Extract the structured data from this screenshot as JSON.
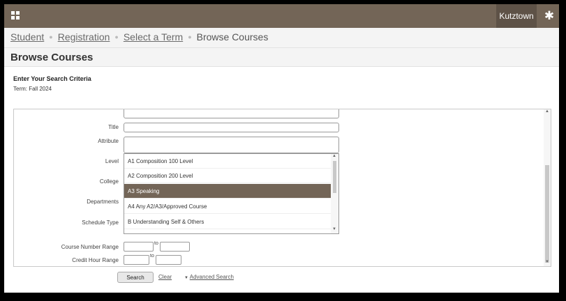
{
  "topbar": {
    "tenant": "Kutztown"
  },
  "breadcrumb": {
    "item1": "Student",
    "item2": "Registration",
    "item3": "Select a Term",
    "current": "Browse Courses"
  },
  "page": {
    "title": "Browse Courses"
  },
  "criteria": {
    "heading": "Enter Your Search Criteria",
    "term": "Term: Fall 2024"
  },
  "form": {
    "title_label": "Title",
    "attribute_label": "Attribute",
    "level_label": "Level",
    "college_label": "College",
    "departments_label": "Departments",
    "schedule_type_label": "Schedule Type",
    "course_number_label": "Course Number Range",
    "credit_hour_label": "Credit Hour Range",
    "to_label": "to"
  },
  "attribute_options": [
    {
      "label": "A1 Composition 100 Level",
      "selected": false
    },
    {
      "label": "A2 Composition 200 Level",
      "selected": false
    },
    {
      "label": "A3 Speaking",
      "selected": true
    },
    {
      "label": "A4 Any A2/A3/Approved Course",
      "selected": false
    },
    {
      "label": "B Understanding Self & Others",
      "selected": false
    }
  ],
  "actions": {
    "search": "Search",
    "clear": "Clear",
    "advanced": "Advanced Search"
  },
  "icons": {
    "menu": "grid-menu-icon",
    "settings": "gear-icon",
    "caret": "caret-down-icon"
  },
  "colors": {
    "brand": "#736557",
    "brand_dark": "#5e5247"
  }
}
